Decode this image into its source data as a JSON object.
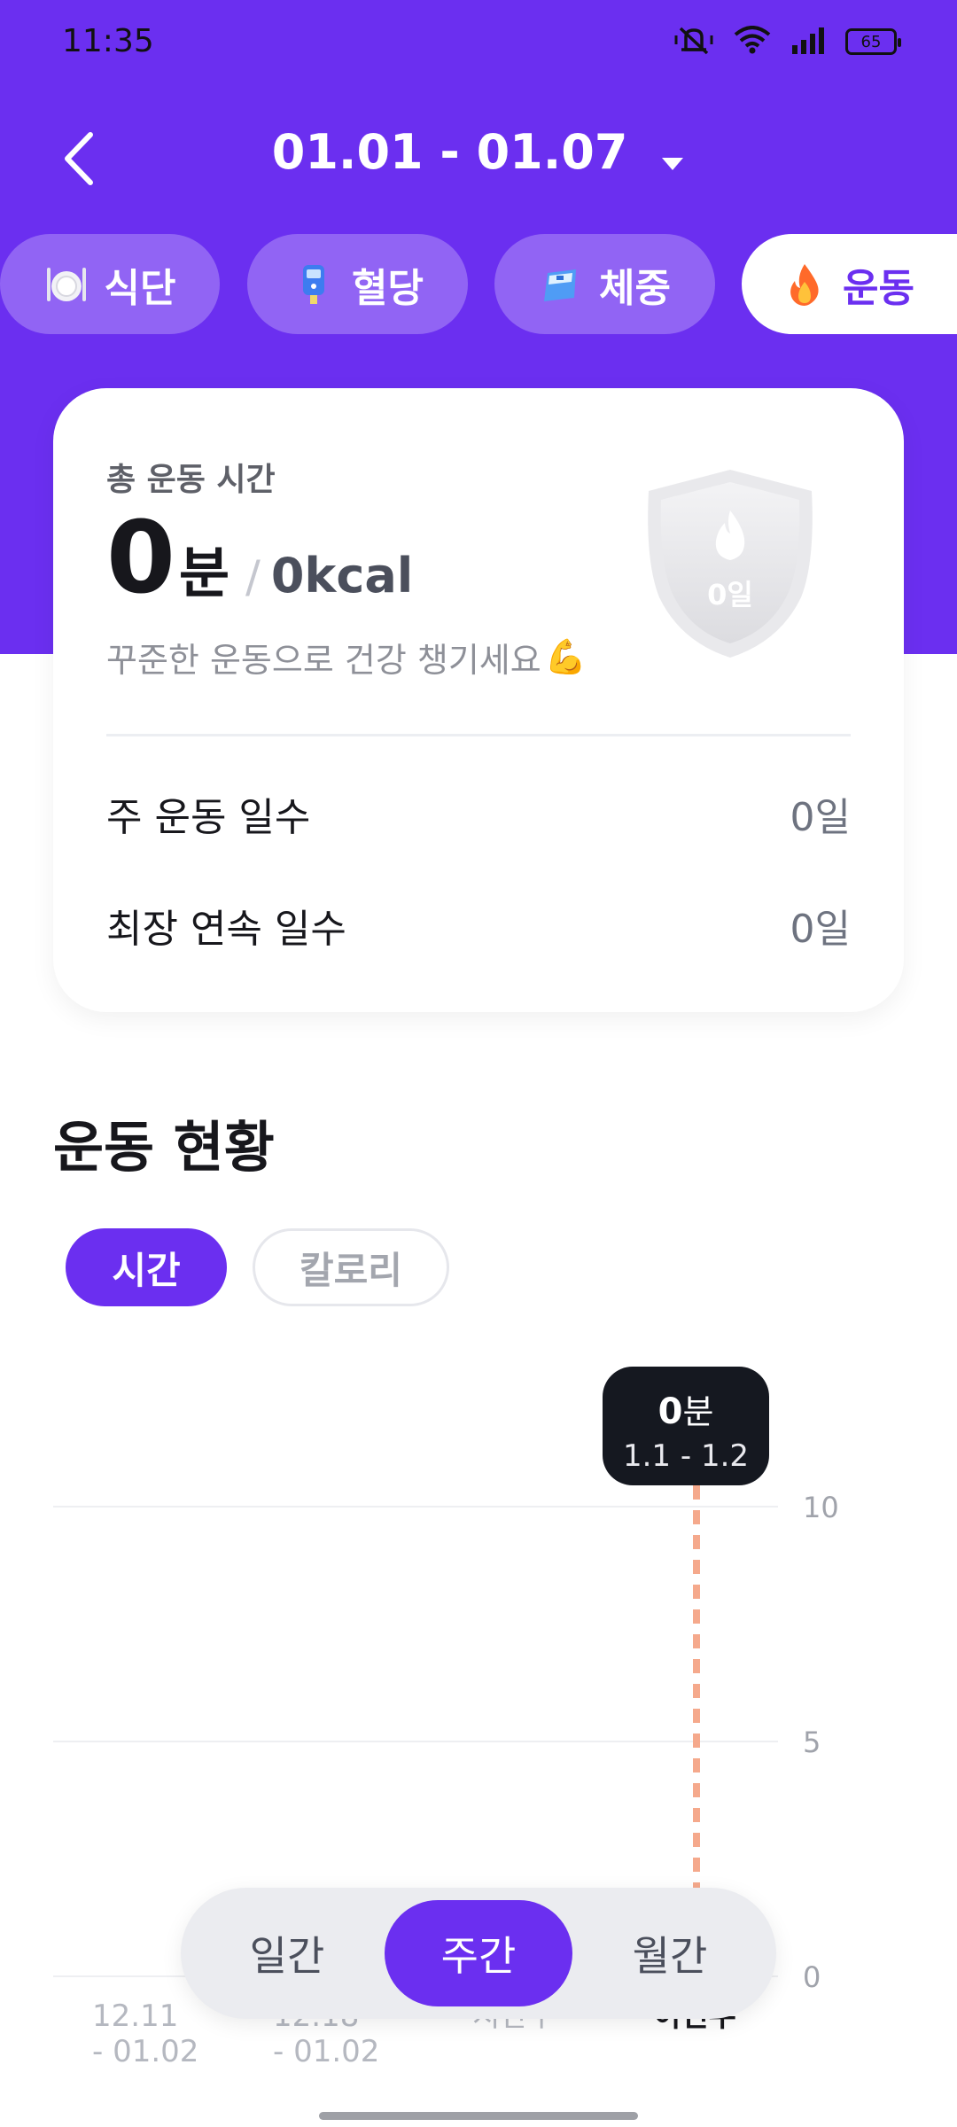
{
  "status_bar": {
    "time": "11:35",
    "battery": "65",
    "icons": [
      "mute-vibrate-icon",
      "wifi-icon",
      "signal-icon",
      "battery-icon"
    ]
  },
  "header": {
    "date_range": "01.01 - 01.07"
  },
  "category_tabs": [
    {
      "label": "식단",
      "icon": "meal-icon",
      "active": false
    },
    {
      "label": "혈당",
      "icon": "glucose-meter-icon",
      "active": false
    },
    {
      "label": "체중",
      "icon": "scale-icon",
      "active": false
    },
    {
      "label": "운동",
      "icon": "fire-icon",
      "active": true
    }
  ],
  "summary": {
    "total_label": "총 운동 시간",
    "minutes": "0",
    "minutes_unit": "분",
    "slash": "/",
    "kcal": "0kcal",
    "motivation": "꾸준한 운동으로 건강 챙기세요",
    "motivation_emoji": "💪",
    "badge_text": "0일",
    "stats": [
      {
        "label": "주 운동 일수",
        "value": "0일"
      },
      {
        "label": "최장 연속 일수",
        "value": "0일"
      }
    ]
  },
  "section": {
    "title": "운동 현황",
    "metric_tabs": [
      {
        "label": "시간",
        "active": true
      },
      {
        "label": "칼로리",
        "active": false
      }
    ]
  },
  "tooltip": {
    "value": "0",
    "unit": "분",
    "range": "1.1 - 1.2"
  },
  "chart_data": {
    "type": "bar",
    "categories": [
      "12.11 - 01.02",
      "12.18 - 01.02",
      "지난주",
      "이번주"
    ],
    "values": [
      0,
      0,
      0,
      0
    ],
    "y_ticks": [
      "0",
      "5",
      "10"
    ],
    "ylim": [
      0,
      10
    ],
    "selected_index": 3,
    "colors": {
      "grid": "#eeeff2",
      "tick": "#a0a3ab",
      "selection_line": "#f5a98c"
    }
  },
  "period_switch": [
    {
      "label": "일간",
      "active": false
    },
    {
      "label": "주간",
      "active": true
    },
    {
      "label": "월간",
      "active": false
    }
  ],
  "colors": {
    "primary": "#6b2ff0",
    "dark": "#151820"
  }
}
